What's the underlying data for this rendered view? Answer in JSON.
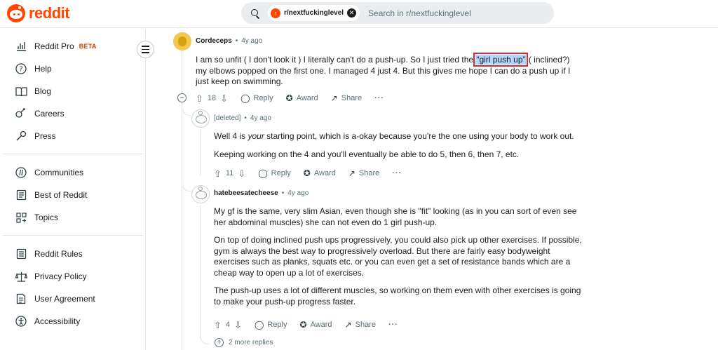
{
  "header": {
    "logo_text": "reddit",
    "search_chip": "r/nextfuckinglevel",
    "search_placeholder": "Search in r/nextfuckinglevel"
  },
  "sidebar": {
    "group1": [
      {
        "label": "Reddit Pro",
        "badge": "BETA",
        "icon": "bar-chart-icon"
      },
      {
        "label": "Help",
        "icon": "help-icon"
      },
      {
        "label": "Blog",
        "icon": "book-icon"
      },
      {
        "label": "Careers",
        "icon": "briefcase-icon"
      },
      {
        "label": "Press",
        "icon": "microphone-icon"
      }
    ],
    "group2": [
      {
        "label": "Communities",
        "icon": "communities-icon"
      },
      {
        "label": "Best of Reddit",
        "icon": "best-of-icon"
      },
      {
        "label": "Topics",
        "icon": "topics-icon"
      }
    ],
    "group3": [
      {
        "label": "Reddit Rules",
        "icon": "rules-icon"
      },
      {
        "label": "Privacy Policy",
        "icon": "scales-icon"
      },
      {
        "label": "User Agreement",
        "icon": "document-icon"
      },
      {
        "label": "Accessibility",
        "icon": "accessibility-icon"
      }
    ]
  },
  "comments": [
    {
      "author": "Cordeceps",
      "age": "4y ago",
      "text_before": "I am so unfit ( I don't look it ) I literally can't do a push-up. So I just tried the ",
      "highlight": "“girl push up”",
      "text_after": " ( inclined?) my elbows popped on the first one. I managed 4 just 4. But this gives me hope I can do a push up if I just keep on swimming.",
      "votes": "18",
      "reply": "Reply",
      "award": "Award",
      "share": "Share",
      "more": "···"
    },
    {
      "author": "[deleted]",
      "age": "4y ago",
      "p1_before": "Well 4 is ",
      "p1_em": "your",
      "p1_after": " starting point, which is a-okay because you're the one using your body to work out.",
      "p2": "Keeping working on the 4 and you'll eventually be able to do 5, then 6, then 7, etc.",
      "votes": "11",
      "reply": "Reply",
      "award": "Award",
      "share": "Share",
      "more": "···"
    },
    {
      "author": "hatebeesatecheese",
      "age": "4y ago",
      "p1": "My gf is the same, very slim Asian, even though she is \"fit\" looking (as in you can sort of even see her abdominal muscles) she can not even do 1 girl push-up.",
      "p2": "On top of doing inclined push ups progressively, you could also pick up other exercises. If possible, gym is always the best way to progressively overload. But there are fairly easy bodyweight exercises such as planks, squats etc. or you can even get a set of resistance bands which are a cheap way to open up a lot of exercises.",
      "p3": "The push-up uses a lot of different muscles, so working on them even with other exercises is going to make your push-up progress faster.",
      "votes": "4",
      "reply": "Reply",
      "award": "Award",
      "share": "Share",
      "more": "···"
    }
  ],
  "more_replies": "2 more replies",
  "dot": "•"
}
